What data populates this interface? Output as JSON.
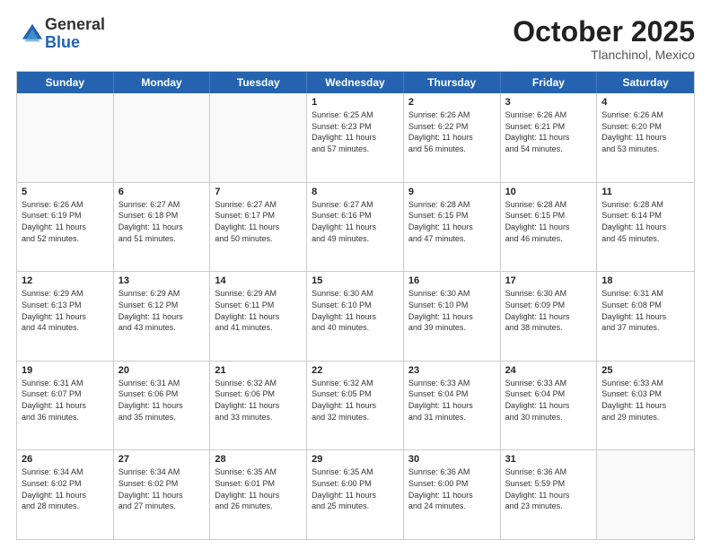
{
  "header": {
    "logo_general": "General",
    "logo_blue": "Blue",
    "month_title": "October 2025",
    "subtitle": "Tlanchinol, Mexico"
  },
  "weekdays": [
    "Sunday",
    "Monday",
    "Tuesday",
    "Wednesday",
    "Thursday",
    "Friday",
    "Saturday"
  ],
  "rows": [
    [
      {
        "day": "",
        "info": ""
      },
      {
        "day": "",
        "info": ""
      },
      {
        "day": "",
        "info": ""
      },
      {
        "day": "1",
        "info": "Sunrise: 6:25 AM\nSunset: 6:23 PM\nDaylight: 11 hours\nand 57 minutes."
      },
      {
        "day": "2",
        "info": "Sunrise: 6:26 AM\nSunset: 6:22 PM\nDaylight: 11 hours\nand 56 minutes."
      },
      {
        "day": "3",
        "info": "Sunrise: 6:26 AM\nSunset: 6:21 PM\nDaylight: 11 hours\nand 54 minutes."
      },
      {
        "day": "4",
        "info": "Sunrise: 6:26 AM\nSunset: 6:20 PM\nDaylight: 11 hours\nand 53 minutes."
      }
    ],
    [
      {
        "day": "5",
        "info": "Sunrise: 6:26 AM\nSunset: 6:19 PM\nDaylight: 11 hours\nand 52 minutes."
      },
      {
        "day": "6",
        "info": "Sunrise: 6:27 AM\nSunset: 6:18 PM\nDaylight: 11 hours\nand 51 minutes."
      },
      {
        "day": "7",
        "info": "Sunrise: 6:27 AM\nSunset: 6:17 PM\nDaylight: 11 hours\nand 50 minutes."
      },
      {
        "day": "8",
        "info": "Sunrise: 6:27 AM\nSunset: 6:16 PM\nDaylight: 11 hours\nand 49 minutes."
      },
      {
        "day": "9",
        "info": "Sunrise: 6:28 AM\nSunset: 6:15 PM\nDaylight: 11 hours\nand 47 minutes."
      },
      {
        "day": "10",
        "info": "Sunrise: 6:28 AM\nSunset: 6:15 PM\nDaylight: 11 hours\nand 46 minutes."
      },
      {
        "day": "11",
        "info": "Sunrise: 6:28 AM\nSunset: 6:14 PM\nDaylight: 11 hours\nand 45 minutes."
      }
    ],
    [
      {
        "day": "12",
        "info": "Sunrise: 6:29 AM\nSunset: 6:13 PM\nDaylight: 11 hours\nand 44 minutes."
      },
      {
        "day": "13",
        "info": "Sunrise: 6:29 AM\nSunset: 6:12 PM\nDaylight: 11 hours\nand 43 minutes."
      },
      {
        "day": "14",
        "info": "Sunrise: 6:29 AM\nSunset: 6:11 PM\nDaylight: 11 hours\nand 41 minutes."
      },
      {
        "day": "15",
        "info": "Sunrise: 6:30 AM\nSunset: 6:10 PM\nDaylight: 11 hours\nand 40 minutes."
      },
      {
        "day": "16",
        "info": "Sunrise: 6:30 AM\nSunset: 6:10 PM\nDaylight: 11 hours\nand 39 minutes."
      },
      {
        "day": "17",
        "info": "Sunrise: 6:30 AM\nSunset: 6:09 PM\nDaylight: 11 hours\nand 38 minutes."
      },
      {
        "day": "18",
        "info": "Sunrise: 6:31 AM\nSunset: 6:08 PM\nDaylight: 11 hours\nand 37 minutes."
      }
    ],
    [
      {
        "day": "19",
        "info": "Sunrise: 6:31 AM\nSunset: 6:07 PM\nDaylight: 11 hours\nand 36 minutes."
      },
      {
        "day": "20",
        "info": "Sunrise: 6:31 AM\nSunset: 6:06 PM\nDaylight: 11 hours\nand 35 minutes."
      },
      {
        "day": "21",
        "info": "Sunrise: 6:32 AM\nSunset: 6:06 PM\nDaylight: 11 hours\nand 33 minutes."
      },
      {
        "day": "22",
        "info": "Sunrise: 6:32 AM\nSunset: 6:05 PM\nDaylight: 11 hours\nand 32 minutes."
      },
      {
        "day": "23",
        "info": "Sunrise: 6:33 AM\nSunset: 6:04 PM\nDaylight: 11 hours\nand 31 minutes."
      },
      {
        "day": "24",
        "info": "Sunrise: 6:33 AM\nSunset: 6:04 PM\nDaylight: 11 hours\nand 30 minutes."
      },
      {
        "day": "25",
        "info": "Sunrise: 6:33 AM\nSunset: 6:03 PM\nDaylight: 11 hours\nand 29 minutes."
      }
    ],
    [
      {
        "day": "26",
        "info": "Sunrise: 6:34 AM\nSunset: 6:02 PM\nDaylight: 11 hours\nand 28 minutes."
      },
      {
        "day": "27",
        "info": "Sunrise: 6:34 AM\nSunset: 6:02 PM\nDaylight: 11 hours\nand 27 minutes."
      },
      {
        "day": "28",
        "info": "Sunrise: 6:35 AM\nSunset: 6:01 PM\nDaylight: 11 hours\nand 26 minutes."
      },
      {
        "day": "29",
        "info": "Sunrise: 6:35 AM\nSunset: 6:00 PM\nDaylight: 11 hours\nand 25 minutes."
      },
      {
        "day": "30",
        "info": "Sunrise: 6:36 AM\nSunset: 6:00 PM\nDaylight: 11 hours\nand 24 minutes."
      },
      {
        "day": "31",
        "info": "Sunrise: 6:36 AM\nSunset: 5:59 PM\nDaylight: 11 hours\nand 23 minutes."
      },
      {
        "day": "",
        "info": ""
      }
    ]
  ]
}
